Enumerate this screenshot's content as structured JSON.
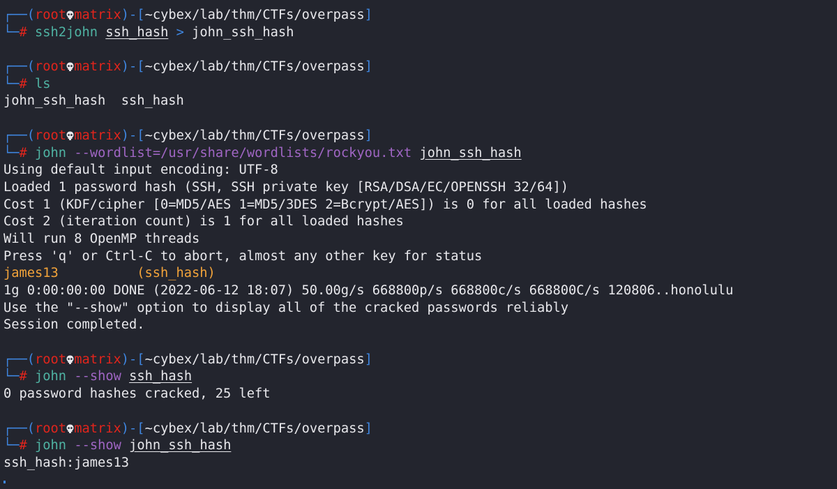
{
  "colors": {
    "background": "#23252e",
    "prompt_frame": "#3f86e0",
    "user_host": "#e2251c",
    "command": "#4fb3a3",
    "option": "#a066c4",
    "found": "#f2a33a",
    "text": "#e8e8ec"
  },
  "prompt": {
    "open": "┌──(",
    "user": "root",
    "skull_icon": "skull-icon",
    "host": "matrix",
    "mid": ")-[",
    "path": "~cybex/lab/thm/CTFs/overpass",
    "close": "]",
    "corner": "└─",
    "hash": "# "
  },
  "lines": [
    {
      "type": "prompt"
    },
    {
      "type": "cmd",
      "segs": [
        {
          "t": "ssh2john",
          "c": "green"
        },
        {
          "t": " "
        },
        {
          "t": "ssh_hash",
          "u": true
        },
        {
          "t": " "
        },
        {
          "t": ">",
          "c": "blue"
        },
        {
          "t": " john_ssh_hash"
        }
      ]
    },
    {
      "type": "blank"
    },
    {
      "type": "prompt"
    },
    {
      "type": "cmd",
      "segs": [
        {
          "t": "ls",
          "c": "green"
        }
      ]
    },
    {
      "type": "out",
      "segs": [
        {
          "t": "john_ssh_hash  ssh_hash"
        }
      ]
    },
    {
      "type": "blank"
    },
    {
      "type": "prompt"
    },
    {
      "type": "cmd",
      "segs": [
        {
          "t": "john",
          "c": "green"
        },
        {
          "t": " "
        },
        {
          "t": "--wordlist=/usr/share/wordlists/rockyou.txt",
          "c": "purple"
        },
        {
          "t": " "
        },
        {
          "t": "john_ssh_hash",
          "u": true
        }
      ]
    },
    {
      "type": "out",
      "segs": [
        {
          "t": "Using default input encoding: UTF-8"
        }
      ]
    },
    {
      "type": "out",
      "segs": [
        {
          "t": "Loaded 1 password hash (SSH, SSH private key [RSA/DSA/EC/OPENSSH 32/64])"
        }
      ]
    },
    {
      "type": "out",
      "segs": [
        {
          "t": "Cost 1 (KDF/cipher [0=MD5/AES 1=MD5/3DES 2=Bcrypt/AES]) is 0 for all loaded hashes"
        }
      ]
    },
    {
      "type": "out",
      "segs": [
        {
          "t": "Cost 2 (iteration count) is 1 for all loaded hashes"
        }
      ]
    },
    {
      "type": "out",
      "segs": [
        {
          "t": "Will run 8 OpenMP threads"
        }
      ]
    },
    {
      "type": "out",
      "segs": [
        {
          "t": "Press 'q' or Ctrl-C to abort, almost any other key for status"
        }
      ]
    },
    {
      "type": "out",
      "segs": [
        {
          "t": "james13          (ssh_hash)",
          "c": "orange"
        }
      ]
    },
    {
      "type": "out",
      "segs": [
        {
          "t": "1g 0:00:00:00 DONE (2022-06-12 18:07) 50.00g/s 668800p/s 668800c/s 668800C/s 120806..honolulu"
        }
      ]
    },
    {
      "type": "out",
      "segs": [
        {
          "t": "Use the \"--show\" option to display all of the cracked passwords reliably"
        }
      ]
    },
    {
      "type": "out",
      "segs": [
        {
          "t": "Session completed."
        }
      ]
    },
    {
      "type": "blank"
    },
    {
      "type": "prompt"
    },
    {
      "type": "cmd",
      "segs": [
        {
          "t": "john",
          "c": "green"
        },
        {
          "t": " "
        },
        {
          "t": "--show",
          "c": "purple"
        },
        {
          "t": " "
        },
        {
          "t": "ssh_hash",
          "u": true
        }
      ]
    },
    {
      "type": "out",
      "segs": [
        {
          "t": "0 password hashes cracked, 25 left"
        }
      ]
    },
    {
      "type": "blank"
    },
    {
      "type": "prompt"
    },
    {
      "type": "cmd",
      "segs": [
        {
          "t": "john",
          "c": "green"
        },
        {
          "t": " "
        },
        {
          "t": "--show",
          "c": "purple"
        },
        {
          "t": " "
        },
        {
          "t": "john_ssh_hash",
          "u": true
        }
      ]
    },
    {
      "type": "out",
      "segs": [
        {
          "t": "ssh_hash:james13"
        }
      ]
    },
    {
      "type": "cursor"
    }
  ]
}
